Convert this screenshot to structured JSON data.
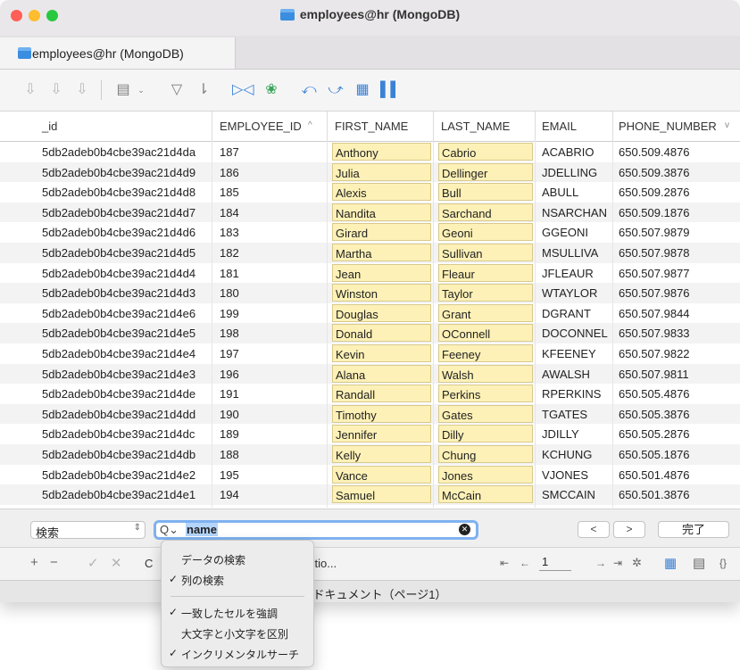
{
  "window": {
    "title": "employees@hr (MongoDB)"
  },
  "tab": {
    "label": "employees@hr (MongoDB)"
  },
  "toolbar": {
    "icons": [
      "add-row-icon",
      "duplicate-row-icon",
      "delete-row-icon",
      "document-icon",
      "filter-icon",
      "sort-icon",
      "split-columns-icon",
      "venn-icon",
      "import-icon",
      "export-icon",
      "table-data-icon",
      "chart-icon"
    ]
  },
  "grid": {
    "columns": [
      "_id",
      "EMPLOYEE_ID",
      "FIRST_NAME",
      "LAST_NAME",
      "EMAIL",
      "PHONE_NUMBER"
    ],
    "sort_indicator": "^",
    "more_indicator": "v",
    "rows": [
      [
        "5db2adeb0b4cbe39ac21d4da",
        "187",
        "Anthony",
        "Cabrio",
        "ACABRIO",
        "650.509.4876"
      ],
      [
        "5db2adeb0b4cbe39ac21d4d9",
        "186",
        "Julia",
        "Dellinger",
        "JDELLING",
        "650.509.3876"
      ],
      [
        "5db2adeb0b4cbe39ac21d4d8",
        "185",
        "Alexis",
        "Bull",
        "ABULL",
        "650.509.2876"
      ],
      [
        "5db2adeb0b4cbe39ac21d4d7",
        "184",
        "Nandita",
        "Sarchand",
        "NSARCHAN",
        "650.509.1876"
      ],
      [
        "5db2adeb0b4cbe39ac21d4d6",
        "183",
        "Girard",
        "Geoni",
        "GGEONI",
        "650.507.9879"
      ],
      [
        "5db2adeb0b4cbe39ac21d4d5",
        "182",
        "Martha",
        "Sullivan",
        "MSULLIVA",
        "650.507.9878"
      ],
      [
        "5db2adeb0b4cbe39ac21d4d4",
        "181",
        "Jean",
        "Fleaur",
        "JFLEAUR",
        "650.507.9877"
      ],
      [
        "5db2adeb0b4cbe39ac21d4d3",
        "180",
        "Winston",
        "Taylor",
        "WTAYLOR",
        "650.507.9876"
      ],
      [
        "5db2adeb0b4cbe39ac21d4e6",
        "199",
        "Douglas",
        "Grant",
        "DGRANT",
        "650.507.9844"
      ],
      [
        "5db2adeb0b4cbe39ac21d4e5",
        "198",
        "Donald",
        "OConnell",
        "DOCONNEL",
        "650.507.9833"
      ],
      [
        "5db2adeb0b4cbe39ac21d4e4",
        "197",
        "Kevin",
        "Feeney",
        "KFEENEY",
        "650.507.9822"
      ],
      [
        "5db2adeb0b4cbe39ac21d4e3",
        "196",
        "Alana",
        "Walsh",
        "AWALSH",
        "650.507.9811"
      ],
      [
        "5db2adeb0b4cbe39ac21d4de",
        "191",
        "Randall",
        "Perkins",
        "RPERKINS",
        "650.505.4876"
      ],
      [
        "5db2adeb0b4cbe39ac21d4dd",
        "190",
        "Timothy",
        "Gates",
        "TGATES",
        "650.505.3876"
      ],
      [
        "5db2adeb0b4cbe39ac21d4dc",
        "189",
        "Jennifer",
        "Dilly",
        "JDILLY",
        "650.505.2876"
      ],
      [
        "5db2adeb0b4cbe39ac21d4db",
        "188",
        "Kelly",
        "Chung",
        "KCHUNG",
        "650.505.1876"
      ],
      [
        "5db2adeb0b4cbe39ac21d4e2",
        "195",
        "Vance",
        "Jones",
        "VJONES",
        "650.501.4876"
      ],
      [
        "5db2adeb0b4cbe39ac21d4e1",
        "194",
        "Samuel",
        "McCain",
        "SMCCAIN",
        "650.501.3876"
      ]
    ]
  },
  "search": {
    "scope_label": "検索",
    "query": "name",
    "prev_label": "<",
    "next_label": ">",
    "done_label": "完了"
  },
  "bottombar": {
    "add": "+",
    "remove": "−",
    "confirm": "✓",
    "cancel": "✕",
    "partial_label": "C",
    "collection_text": "ctio...",
    "page_value": "1"
  },
  "status": {
    "text": "07ドキュメント（ページ1）"
  },
  "menu": {
    "items": [
      {
        "label": "データの検索",
        "checked": false
      },
      {
        "label": "列の検索",
        "checked": true
      },
      {
        "label": "一致したセルを強調",
        "checked": true
      },
      {
        "label": "大文字と小文字を区別",
        "checked": false
      },
      {
        "label": "インクリメンタルサーチ",
        "checked": true
      }
    ],
    "check_glyph": "✓"
  },
  "colors": {
    "highlight_fill": "#fdf1b7",
    "search_focus": "#7fb1ef",
    "selection": "#b4d4fb"
  }
}
